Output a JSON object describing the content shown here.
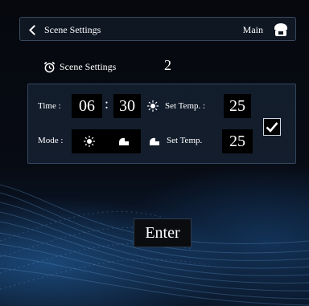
{
  "header": {
    "back_label": "Scene Settings",
    "main_label": "Main",
    "home_icon": "home-icon"
  },
  "scene": {
    "title": "Scene Settings",
    "number": "2",
    "icon": "alarm-clock-icon"
  },
  "panel": {
    "time_label": "Time :",
    "hour": "06",
    "separator": ":",
    "minute": "30",
    "sun_icon": "sun-icon",
    "set_temp_label_1": "Set Temp. :",
    "temp_1": "25",
    "mode_label": "Mode :",
    "mode_icons": [
      "sun-icon",
      "fan-icon"
    ],
    "fan_icon": "fan-icon",
    "set_temp_label_2": "Set Temp.",
    "temp_2": "25",
    "checkbox_checked": true
  },
  "enter_label": "Enter",
  "colors": {
    "background": "#07090f",
    "panel_border": "#34475f",
    "box_fill": "#000000",
    "text": "#ffffff"
  }
}
